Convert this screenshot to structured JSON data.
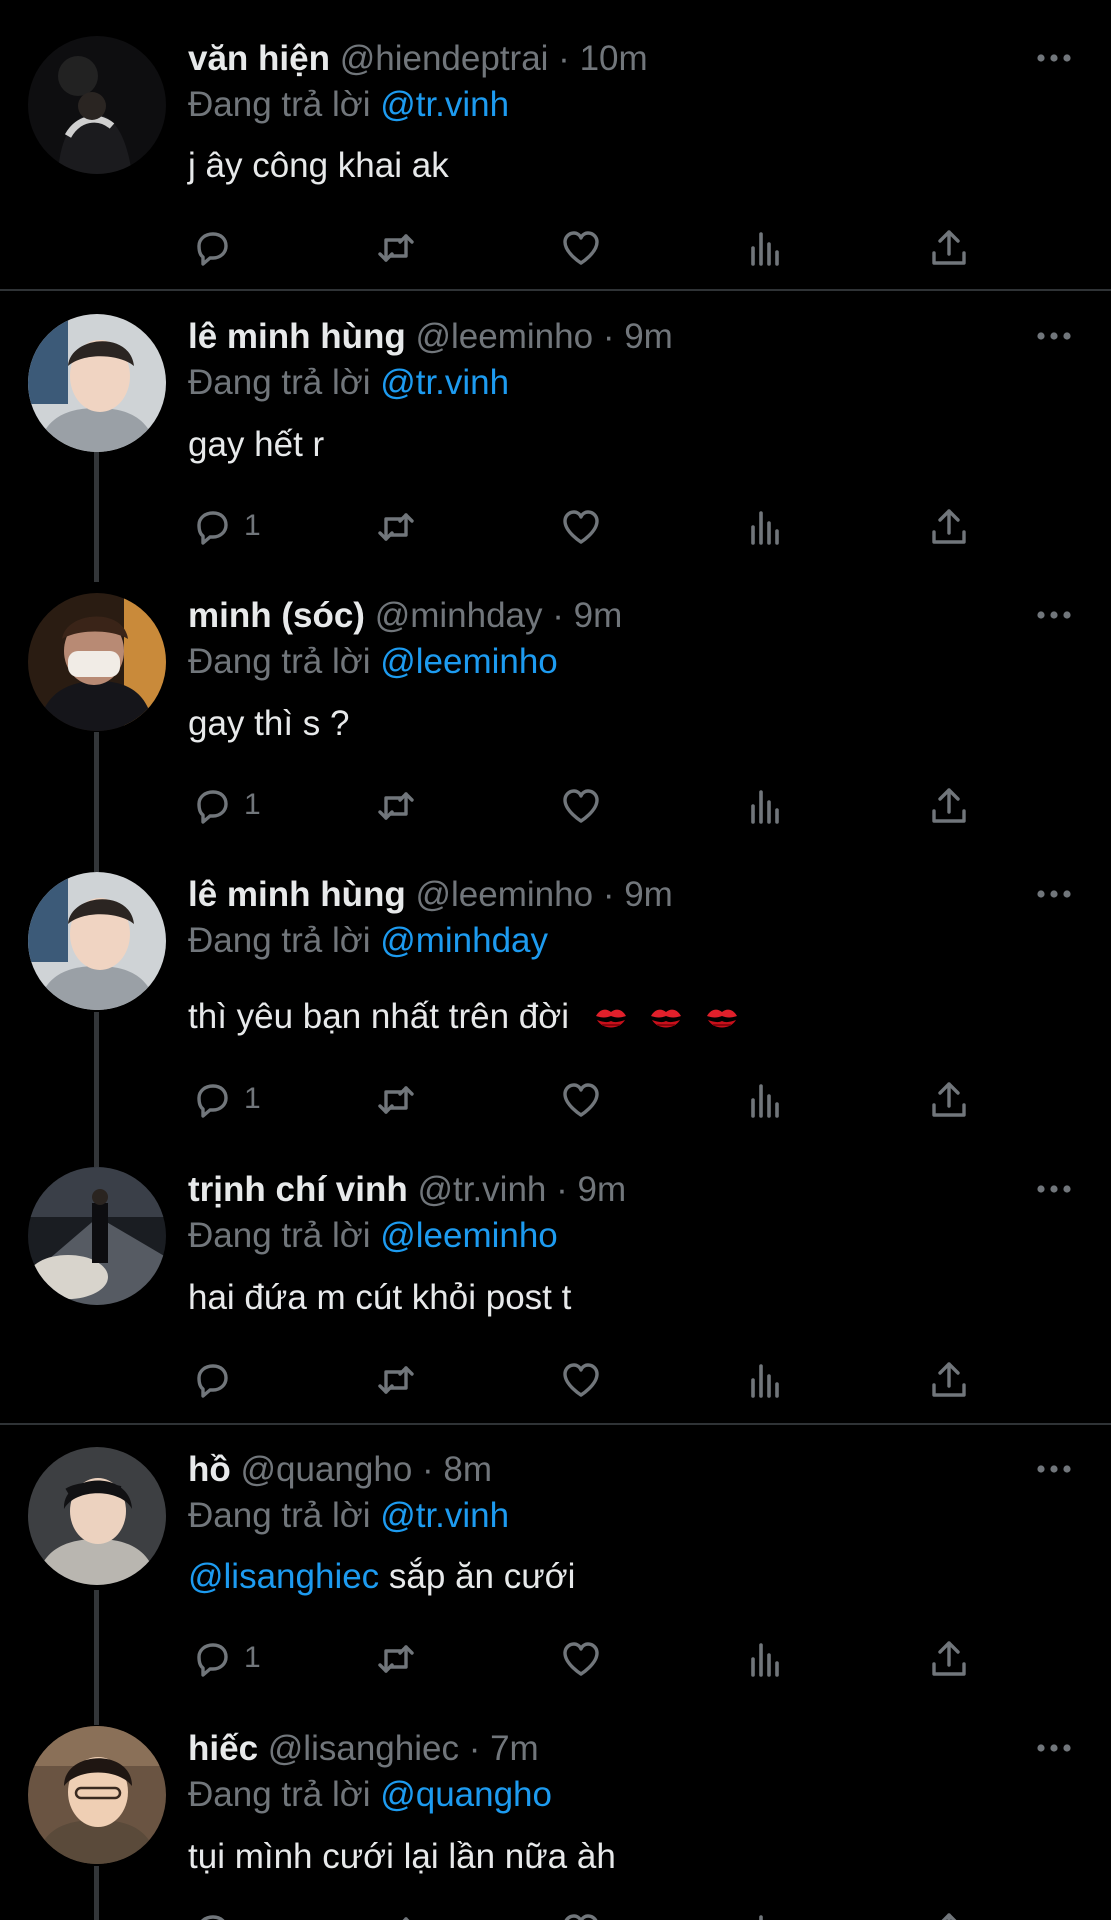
{
  "replying_label": "Đang trả lời",
  "colors": {
    "background": "#000000",
    "text": "#e7e9ea",
    "secondary": "#71767b",
    "link": "#1d9bf0",
    "divider": "#2f3336"
  },
  "tweets": [
    {
      "name": "văn hiện",
      "handle": "@hiendeptrai",
      "time": "10m",
      "reply_to": "@tr.vinh",
      "text": "j ây công khai ak",
      "reply_count": ""
    },
    {
      "name": "lê minh hùng",
      "handle": "@leeminho",
      "time": "9m",
      "reply_to": "@tr.vinh",
      "text": "gay hết r",
      "reply_count": "1"
    },
    {
      "name": "minh (sóc)",
      "handle": "@minhday",
      "time": "9m",
      "reply_to": "@leeminho",
      "text": "gay thì s ?",
      "reply_count": "1"
    },
    {
      "name": "lê minh hùng",
      "handle": "@leeminho",
      "time": "9m",
      "reply_to": "@minhday",
      "text": "thì yêu bạn nhất trên đời",
      "emoji": [
        "kiss-mark",
        "kiss-mark",
        "kiss-mark"
      ],
      "reply_count": "1"
    },
    {
      "name": "trịnh chí vinh",
      "handle": "@tr.vinh",
      "time": "9m",
      "reply_to": "@leeminho",
      "text": "hai đứa m cút khỏi post t",
      "reply_count": ""
    },
    {
      "name": "hồ",
      "handle": "@quangho",
      "time": "8m",
      "reply_to": "@tr.vinh",
      "text_mention": "@lisanghiec",
      "text": "sắp ăn cưới",
      "reply_count": "1"
    },
    {
      "name": "hiếc",
      "handle": "@lisanghiec",
      "time": "7m",
      "reply_to": "@quangho",
      "text": "tụi mình cưới lại lần nữa àh",
      "reply_count": ""
    }
  ]
}
